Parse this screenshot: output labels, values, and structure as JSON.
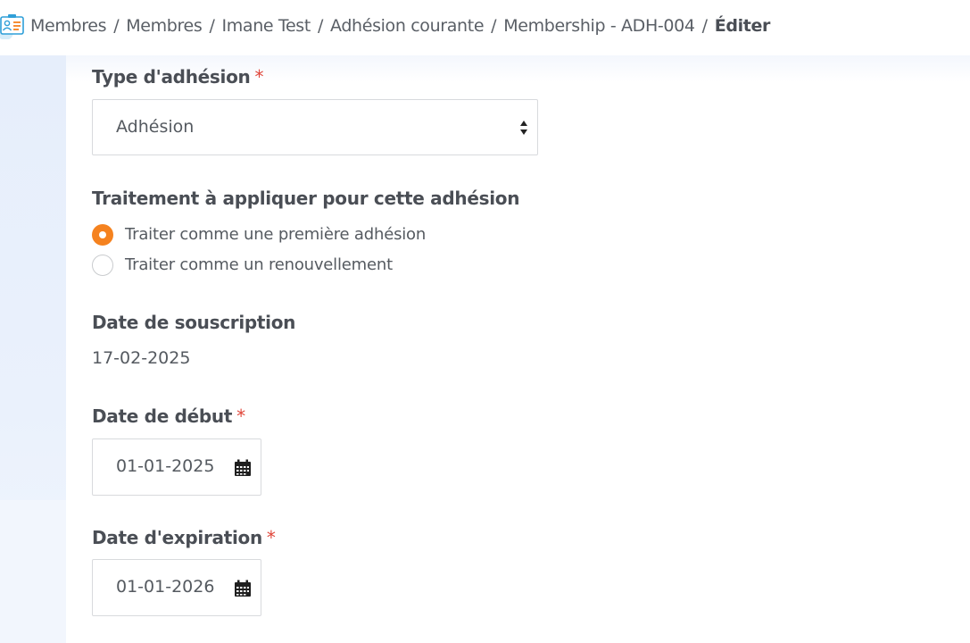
{
  "breadcrumb": {
    "items": [
      "Membres",
      "Membres",
      "Imane Test",
      "Adhésion courante",
      "Membership - ADH-004"
    ],
    "current": "Éditer",
    "separator": "/"
  },
  "form": {
    "membership_type": {
      "label": "Type d'adhésion",
      "required_mark": "*",
      "selected": "Adhésion"
    },
    "treatment": {
      "label": "Traitement à appliquer pour cette adhésion",
      "options": [
        {
          "label": "Traiter comme une première adhésion",
          "selected": true
        },
        {
          "label": "Traiter comme un renouvellement",
          "selected": false
        }
      ]
    },
    "subscription_date": {
      "label": "Date de souscription",
      "value": "17-02-2025"
    },
    "start_date": {
      "label": "Date de début",
      "required_mark": "*",
      "value": "01-01-2025"
    },
    "expiration_date": {
      "label": "Date d'expiration",
      "required_mark": "*",
      "value": "01-01-2026"
    }
  },
  "colors": {
    "accent": "#f5821f",
    "required": "#e0463a",
    "text": "#4a4e55"
  }
}
